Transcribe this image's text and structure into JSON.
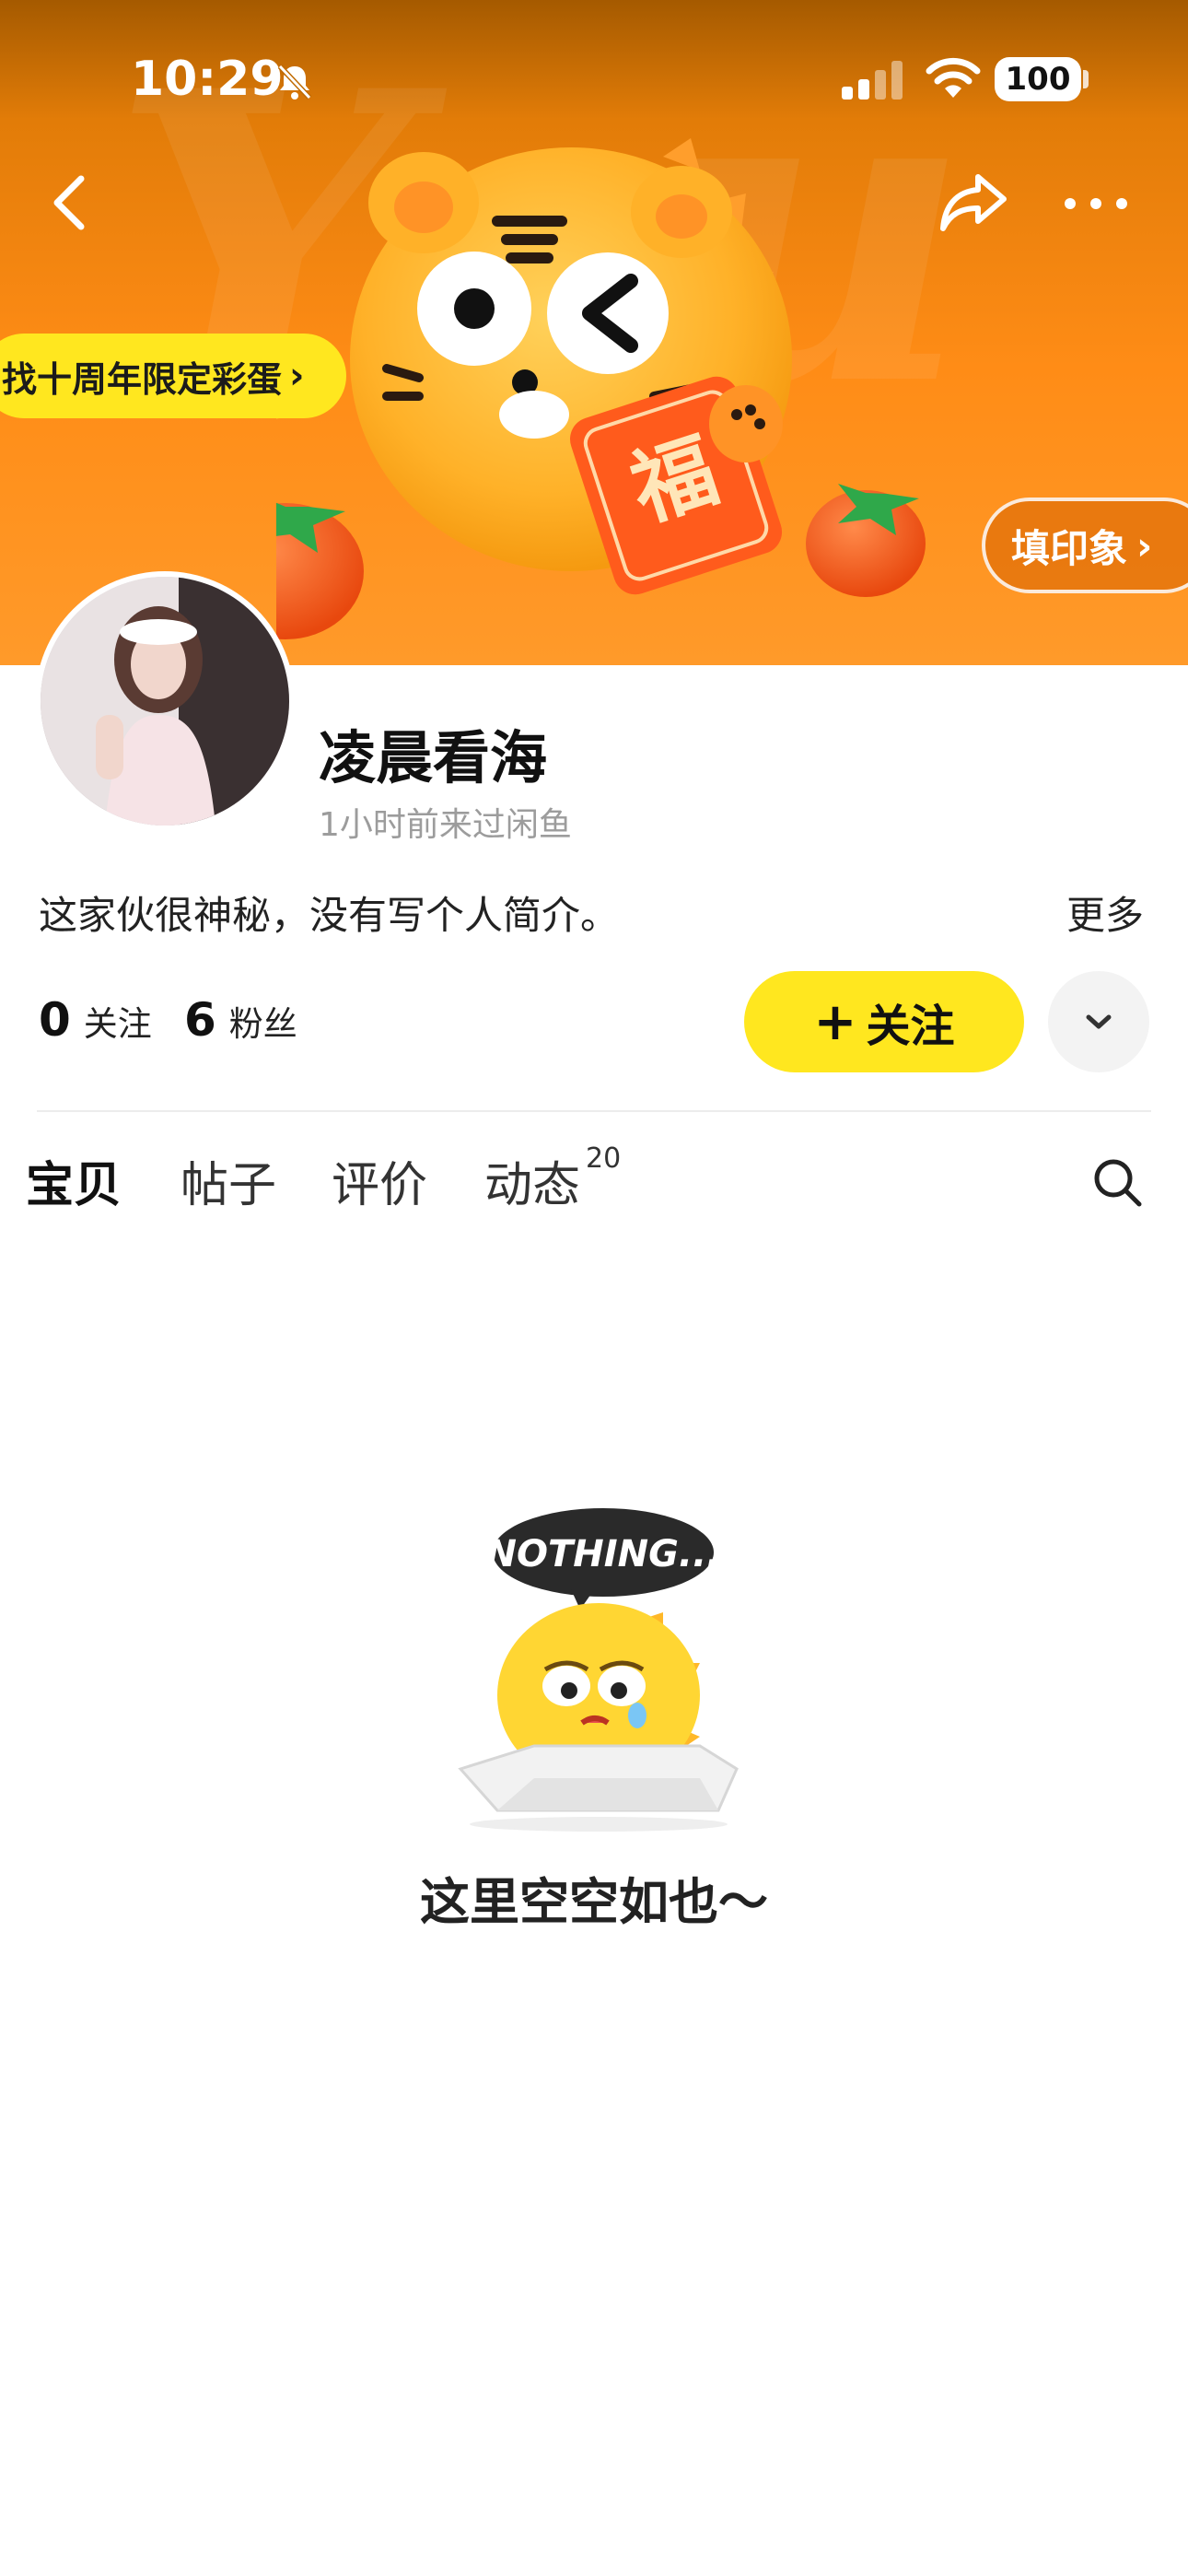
{
  "status_bar": {
    "time": "10:29",
    "battery": "100"
  },
  "banner": {
    "easter_egg_label": "找十周年限定彩蛋",
    "impression_label": "填印象",
    "chevron": "›"
  },
  "profile": {
    "name": "凌晨看海",
    "last_visit": "1小时前来过闲鱼",
    "bio": "这家伙很神秘，没有写个人简介。",
    "bio_more": "更多"
  },
  "stats": {
    "following_count": "0",
    "following_label": "关注",
    "fans_count": "6",
    "fans_label": "粉丝"
  },
  "actions": {
    "follow_plus": "+",
    "follow_label": "关注"
  },
  "tabs": [
    {
      "label": "宝贝"
    },
    {
      "label": "帖子"
    },
    {
      "label": "评价"
    },
    {
      "label": "动态",
      "count": "20"
    }
  ],
  "empty_state": {
    "badge_text": "NOTHING...",
    "message": "这里空空如也～"
  },
  "colors": {
    "accent_yellow": "#ffe71f",
    "banner_orange": "#ff8c16"
  },
  "icons": [
    "bell-mute-icon",
    "signal-icon",
    "wifi-icon",
    "battery-icon",
    "back-icon",
    "share-icon",
    "more-icon",
    "chevron-down-icon",
    "search-icon"
  ]
}
